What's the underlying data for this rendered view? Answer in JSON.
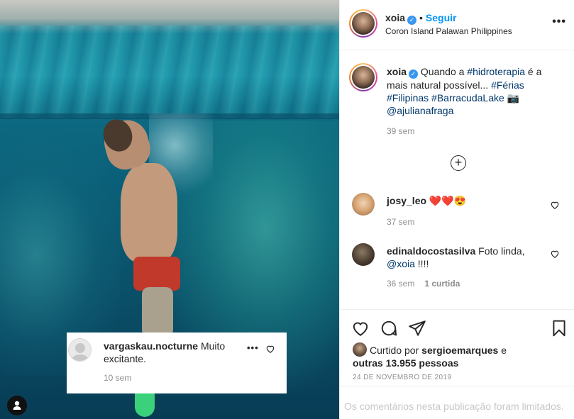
{
  "post": {
    "username": "xoia",
    "follow_label": "Seguir",
    "location": "Coron Island Palawan Philippines",
    "separator": "•"
  },
  "caption": {
    "username": "xoia",
    "text_1": "Quando a ",
    "tag_1": "#hidroterapia",
    "text_2": " é a mais natural possível... ",
    "tag_2": "#Férias",
    "tag_3": "#Filipinas",
    "tag_4": "#BarracudaLake",
    "camera_emoji": "📷",
    "mention": "@ajulianafraga",
    "time": "39 sem"
  },
  "comments": [
    {
      "username": "josy_leo",
      "text": "❤️❤️😍",
      "time": "37 sem",
      "likes": ""
    },
    {
      "username": "edinaldocostasilva",
      "text": "Foto linda,",
      "mention": "@xoia",
      "text_after": " !!!!",
      "time": "36 sem",
      "likes": "1 curtida"
    }
  ],
  "floating_comment": {
    "username": "vargaskau.nocturne",
    "text": " Muito excitante.",
    "time": "10 sem",
    "more": "•••"
  },
  "likes": {
    "prefix": "Curtido por ",
    "user": "sergioemarques",
    "middle": " e ",
    "others": "outras 13.955 pessoas"
  },
  "date": "24 DE NOVEMBRO DE 2019",
  "limited_notice": "Os comentários nesta publicação foram limitados.",
  "more_dots": "•••",
  "load_more_symbol": "+",
  "verified_symbol": "✓",
  "icons": {
    "like": "heart-outline-icon",
    "comment": "comment-bubble-icon",
    "share": "paper-plane-icon",
    "save": "bookmark-icon",
    "options": "ellipsis-icon",
    "load_more": "plus-circle-icon"
  },
  "colors": {
    "link": "#00376b",
    "follow": "#0095f6",
    "verified": "#3897f0",
    "muted": "#8e8e8e"
  }
}
